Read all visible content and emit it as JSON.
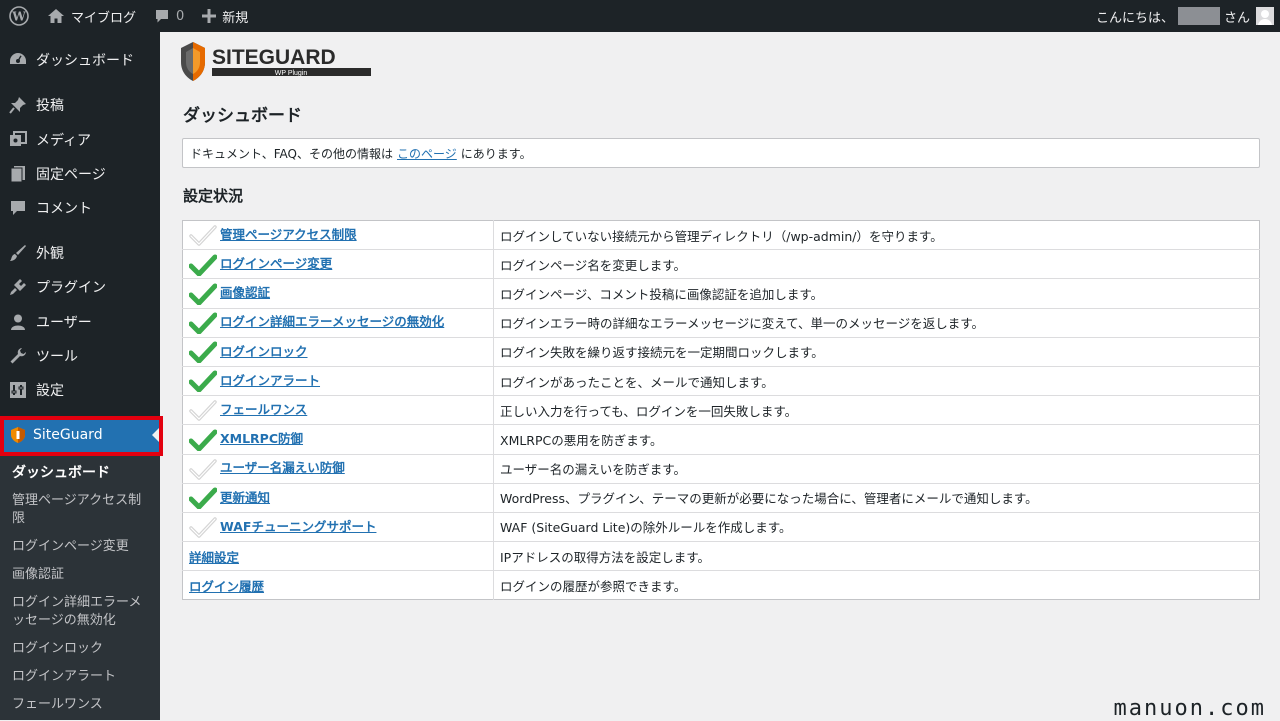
{
  "admin_bar": {
    "site_name": "マイブログ",
    "comment_count": "0",
    "new_label": "新規",
    "greeting": "こんにちは、",
    "greeting_suffix": "さん"
  },
  "sidebar": {
    "items": [
      {
        "label": "ダッシュボード",
        "icon": "dashboard-icon"
      },
      {
        "label": "投稿",
        "icon": "pin-icon"
      },
      {
        "label": "メディア",
        "icon": "media-icon"
      },
      {
        "label": "固定ページ",
        "icon": "page-icon"
      },
      {
        "label": "コメント",
        "icon": "comment-icon"
      },
      {
        "label": "外観",
        "icon": "brush-icon"
      },
      {
        "label": "プラグイン",
        "icon": "plugin-icon"
      },
      {
        "label": "ユーザー",
        "icon": "user-icon"
      },
      {
        "label": "ツール",
        "icon": "wrench-icon"
      },
      {
        "label": "設定",
        "icon": "settings-icon"
      }
    ],
    "siteguard": {
      "label": "SiteGuard",
      "icon": "siteguard-icon"
    },
    "submenu": [
      {
        "label": "ダッシュボード",
        "current": true
      },
      {
        "label": "管理ページアクセス制限"
      },
      {
        "label": "ログインページ変更"
      },
      {
        "label": "画像認証"
      },
      {
        "label": "ログイン詳細エラーメッセージの無効化"
      },
      {
        "label": "ログインロック"
      },
      {
        "label": "ログインアラート"
      },
      {
        "label": "フェールワンス"
      }
    ]
  },
  "logo": {
    "brand": "SITEGUARD",
    "subtitle": "WP Plugin"
  },
  "page": {
    "title": "ダッシュボード",
    "notice_prefix": "ドキュメント、FAQ、その他の情報は",
    "notice_link": "このページ",
    "notice_suffix": "にあります。",
    "section_title": "設定状況"
  },
  "features": [
    {
      "name": "管理ページアクセス制限",
      "status": "off",
      "description": "ログインしていない接続元から管理ディレクトリ（/wp-admin/）を守ります。"
    },
    {
      "name": "ログインページ変更",
      "status": "on",
      "description": "ログインページ名を変更します。"
    },
    {
      "name": "画像認証",
      "status": "on",
      "description": "ログインページ、コメント投稿に画像認証を追加します。"
    },
    {
      "name": "ログイン詳細エラーメッセージの無効化",
      "status": "on",
      "description": "ログインエラー時の詳細なエラーメッセージに変えて、単一のメッセージを返します。"
    },
    {
      "name": "ログインロック",
      "status": "on",
      "description": "ログイン失敗を繰り返す接続元を一定期間ロックします。"
    },
    {
      "name": "ログインアラート",
      "status": "on",
      "description": "ログインがあったことを、メールで通知します。"
    },
    {
      "name": "フェールワンス",
      "status": "off",
      "description": "正しい入力を行っても、ログインを一回失敗します。"
    },
    {
      "name": "XMLRPC防御",
      "status": "on",
      "description": "XMLRPCの悪用を防ぎます。"
    },
    {
      "name": "ユーザー名漏えい防御",
      "status": "off",
      "description": "ユーザー名の漏えいを防ぎます。"
    },
    {
      "name": "更新通知",
      "status": "on",
      "description": "WordPress、プラグイン、テーマの更新が必要になった場合に、管理者にメールで通知します。"
    },
    {
      "name": "WAFチューニングサポート",
      "status": "off",
      "description": "WAF (SiteGuard Lite)の除外ルールを作成します。"
    },
    {
      "name": "詳細設定",
      "status": "none",
      "description": "IPアドレスの取得方法を設定します。"
    },
    {
      "name": "ログイン履歴",
      "status": "none",
      "description": "ログインの履歴が参照できます。"
    }
  ],
  "watermark": "manuon.com",
  "colors": {
    "check_on": "#3bab4b",
    "check_off": "#d5d5d5",
    "highlight": "#e3000f",
    "accent": "#2271b1"
  }
}
